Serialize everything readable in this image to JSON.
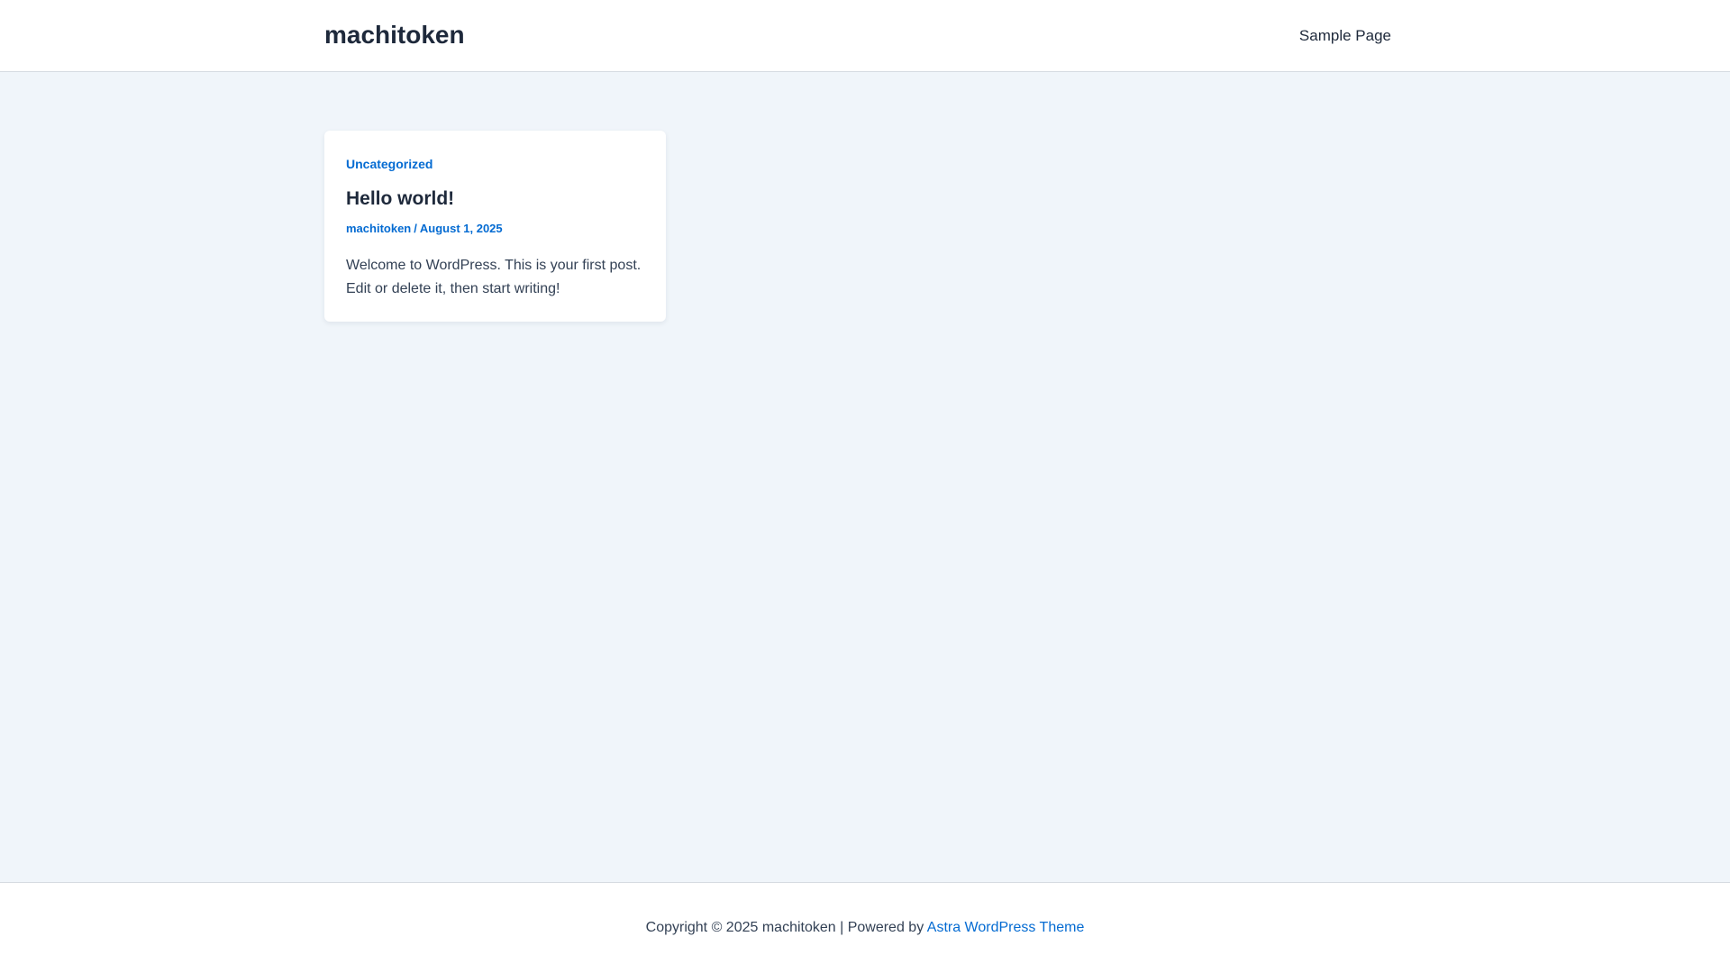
{
  "header": {
    "site_title": "machitoken",
    "nav": [
      {
        "label": "Sample Page"
      }
    ]
  },
  "post": {
    "category": "Uncategorized",
    "title": "Hello world!",
    "author": "machitoken",
    "separator": "/",
    "date": "August 1, 2025",
    "excerpt": "Welcome to WordPress. This is your first post. Edit or delete it, then start writing!"
  },
  "footer": {
    "copyright": "Copyright © 2025 machitoken | Powered by",
    "theme_link": "Astra WordPress Theme"
  },
  "colors": {
    "accent": "#046bd2",
    "heading": "#1e293b",
    "text": "#334155",
    "background": "#f0f5fa"
  }
}
